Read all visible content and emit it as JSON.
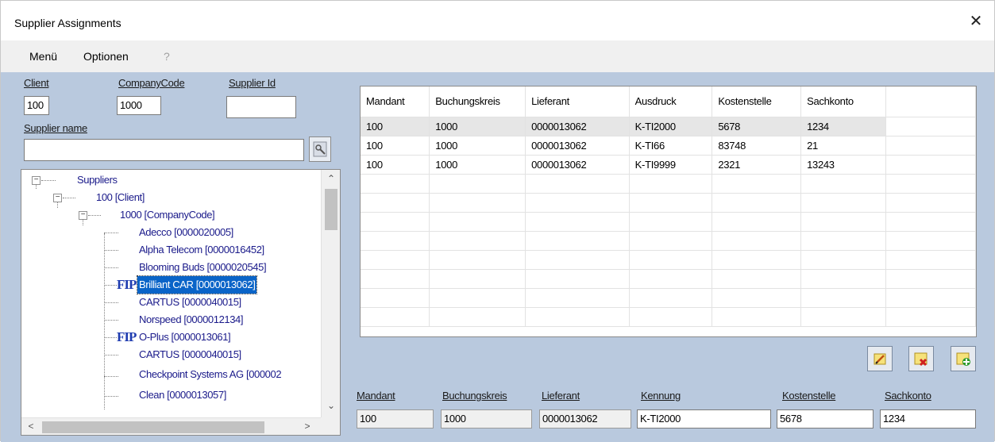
{
  "window": {
    "title": "Supplier Assignments",
    "close_glyph": "✕"
  },
  "menu": {
    "items": [
      "Menü",
      "Optionen",
      "?"
    ]
  },
  "filters": {
    "client_label": "Client",
    "client_value": "100",
    "company_code_label": "CompanyCode",
    "company_code_value": "1000",
    "supplier_id_label": "Supplier Id",
    "supplier_id_value": "",
    "supplier_name_label": "Supplier name",
    "supplier_name_value": "",
    "search_button_icon": "search-icon"
  },
  "tree": {
    "root": "Suppliers",
    "client": "100 [Client]",
    "company_code": "1000 [CompanyCode]",
    "fip_marker": "FIP",
    "suppliers": [
      {
        "label": "Adecco [0000020005]",
        "fip": false,
        "selected": false
      },
      {
        "label": "Alpha Telecom [0000016452]",
        "fip": false,
        "selected": false
      },
      {
        "label": "Blooming Buds [0000020545]",
        "fip": false,
        "selected": false
      },
      {
        "label": "Brilliant CAR [0000013062]",
        "fip": true,
        "selected": true
      },
      {
        "label": "CARTUS [0000040015]",
        "fip": false,
        "selected": false
      },
      {
        "label": "Norspeed [0000012134]",
        "fip": false,
        "selected": false
      },
      {
        "label": "O-Plus [0000013061]",
        "fip": true,
        "selected": false
      },
      {
        "label": "CARTUS [0000040015]",
        "fip": false,
        "selected": false
      },
      {
        "label": "Checkpoint Systems AG [000002",
        "fip": false,
        "selected": false
      },
      {
        "label": "Clean [0000013057]",
        "fip": false,
        "selected": false
      }
    ]
  },
  "grid": {
    "columns": [
      "Mandant",
      "Buchungskreis",
      "Lieferant",
      "Ausdruck",
      "Kostenstelle",
      "Sachkonto"
    ],
    "rows": [
      [
        "100",
        "1000",
        "0000013062",
        "K-TI2000",
        "5678",
        "1234"
      ],
      [
        "100",
        "1000",
        "0000013062",
        "K-TI66",
        "83748",
        "21"
      ],
      [
        "100",
        "1000",
        "0000013062",
        "K-TI9999",
        "2321",
        "13243"
      ]
    ],
    "selected_row": 0
  },
  "actions": [
    {
      "name": "edit-button",
      "icon": "edit-icon"
    },
    {
      "name": "delete-button",
      "icon": "delete-icon"
    },
    {
      "name": "add-button",
      "icon": "add-icon"
    }
  ],
  "detail": {
    "mandant_label": "Mandant",
    "mandant_value": "100",
    "buchungskreis_label": "Buchungskreis",
    "buchungskreis_value": "1000",
    "lieferant_label": "Lieferant",
    "lieferant_value": "0000013062",
    "kennung_label": "Kennung",
    "kennung_value": "K-TI2000",
    "kostenstelle_label": "Kostenstelle",
    "kostenstelle_value": "5678",
    "sachkonto_label": "Sachkonto",
    "sachkonto_value": "1234"
  }
}
